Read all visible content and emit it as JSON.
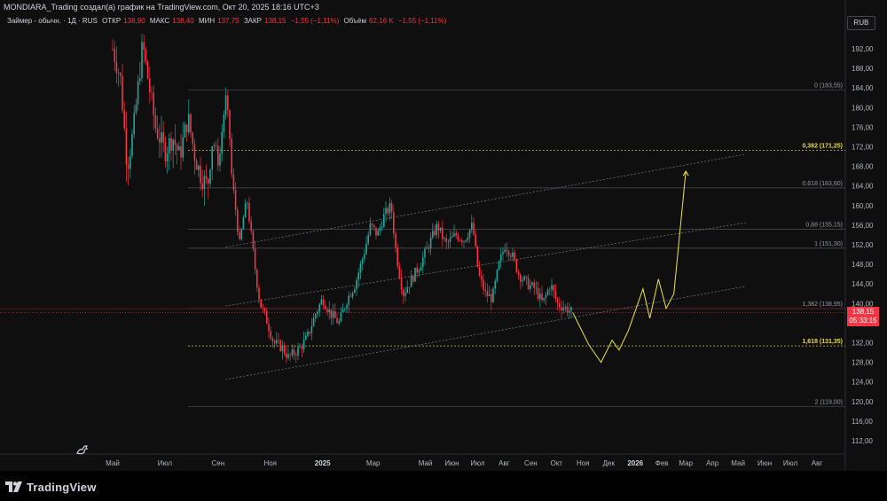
{
  "header": {
    "title": "MONDIARA_Trading создал(а) график на TradingView.com, Окт 20, 2025 18:16 UTC+3"
  },
  "symbol": {
    "name": "Займер - обычн. · 1Д · RUS",
    "open_label": "ОТКР",
    "open": "138,90",
    "high_label": "МАКС",
    "high": "138,40",
    "low_label": "МИН",
    "low": "137,75",
    "close_label": "ЗАКР",
    "close": "138,15",
    "change": "−1,55 (−1,11%)",
    "volume_label": "Объём",
    "volume": "62,16 K",
    "volume_change": "−1,55 (−1,11%)"
  },
  "currency": "RUB",
  "last_price": {
    "value": "138,15",
    "countdown": "05:33:15"
  },
  "footer": {
    "brand": "TradingView"
  },
  "colors": {
    "up": "#26a69a",
    "down": "#f23645",
    "projection": "#f0e34a",
    "fib_gray": "#787b86",
    "fib_highlight": "#e8d84a",
    "background": "#0f0f0f"
  },
  "chart_data": {
    "type": "candlestick",
    "title": "",
    "xlabel": "",
    "ylabel": "",
    "ylim": [
      111,
      194
    ],
    "y_ticks": [
      "192,00",
      "188,00",
      "184,00",
      "180,00",
      "176,00",
      "172,00",
      "168,00",
      "164,00",
      "160,00",
      "156,00",
      "152,00",
      "148,00",
      "144,00",
      "140,00",
      "136,00",
      "132,00",
      "128,00",
      "124,00",
      "120,00",
      "116,00",
      "112,00"
    ],
    "x_ticks": [
      "Май",
      "Июл",
      "Сен",
      "Ноя",
      "2025",
      "Мар",
      "Май",
      "Июн",
      "Июл",
      "Авг",
      "Сен",
      "Окт",
      "Ноя",
      "Дек",
      "2026",
      "Фев",
      "Мар",
      "Апр",
      "Май",
      "Июн",
      "Июл",
      "Авг"
    ],
    "fib_levels": [
      {
        "label": "0 (183,55)",
        "price": 183.55,
        "highlight": false
      },
      {
        "label": "0,382 (171,25)",
        "price": 171.25,
        "highlight": true
      },
      {
        "label": "0,618 (163,60)",
        "price": 163.6,
        "highlight": false
      },
      {
        "label": "0,88 (155,15)",
        "price": 155.15,
        "highlight": false
      },
      {
        "label": "1 (151,30)",
        "price": 151.3,
        "highlight": false
      },
      {
        "label": "1,382 (138,95)",
        "price": 138.95,
        "highlight": false
      },
      {
        "label": "1,618 (131,35)",
        "price": 131.35,
        "highlight": true
      },
      {
        "label": "2 (119,00)",
        "price": 119.0,
        "highlight": false
      }
    ],
    "current_price": 138.15,
    "price_path": [
      [
        "2024-05-01",
        192
      ],
      [
        "2024-05-10",
        186
      ],
      [
        "2024-05-18",
        168
      ],
      [
        "2024-05-25",
        175
      ],
      [
        "2024-06-05",
        193
      ],
      [
        "2024-06-12",
        185
      ],
      [
        "2024-06-20",
        176
      ],
      [
        "2024-07-01",
        171
      ],
      [
        "2024-07-10",
        174
      ],
      [
        "2024-07-18",
        170
      ],
      [
        "2024-07-28",
        178
      ],
      [
        "2024-08-05",
        170
      ],
      [
        "2024-08-12",
        166
      ],
      [
        "2024-08-20",
        164
      ],
      [
        "2024-08-25",
        173
      ],
      [
        "2024-08-29",
        172
      ],
      [
        "2024-09-02",
        168
      ],
      [
        "2024-09-06",
        176
      ],
      [
        "2024-09-10",
        182
      ],
      [
        "2024-09-14",
        176
      ],
      [
        "2024-09-17",
        166
      ],
      [
        "2024-09-21",
        160
      ],
      [
        "2024-09-26",
        152
      ],
      [
        "2024-10-01",
        158
      ],
      [
        "2024-10-05",
        161
      ],
      [
        "2024-10-11",
        152
      ],
      [
        "2024-10-15",
        146
      ],
      [
        "2024-10-20",
        140
      ],
      [
        "2024-10-27",
        137
      ],
      [
        "2024-11-05",
        132
      ],
      [
        "2024-11-15",
        131
      ],
      [
        "2024-11-22",
        129
      ],
      [
        "2024-11-30",
        130
      ],
      [
        "2024-12-06",
        131
      ],
      [
        "2024-12-14",
        133
      ],
      [
        "2024-12-24",
        138
      ],
      [
        "2025-01-01",
        141
      ],
      [
        "2025-01-10",
        138
      ],
      [
        "2025-01-20",
        136
      ],
      [
        "2025-01-30",
        141
      ],
      [
        "2025-02-08",
        144
      ],
      [
        "2025-02-18",
        150
      ],
      [
        "2025-02-26",
        156
      ],
      [
        "2025-03-06",
        154
      ],
      [
        "2025-03-14",
        158
      ],
      [
        "2025-03-22",
        160
      ],
      [
        "2025-03-28",
        150
      ],
      [
        "2025-04-05",
        142
      ],
      [
        "2025-04-15",
        145
      ],
      [
        "2025-04-25",
        148
      ],
      [
        "2025-05-05",
        152
      ],
      [
        "2025-05-15",
        156
      ],
      [
        "2025-05-25",
        152
      ],
      [
        "2025-06-05",
        154
      ],
      [
        "2025-06-15",
        153
      ],
      [
        "2025-06-25",
        156
      ],
      [
        "2025-07-02",
        146
      ],
      [
        "2025-07-10",
        142
      ],
      [
        "2025-07-18",
        141
      ],
      [
        "2025-07-26",
        148
      ],
      [
        "2025-08-02",
        152
      ],
      [
        "2025-08-10",
        150
      ],
      [
        "2025-08-18",
        146
      ],
      [
        "2025-08-28",
        144
      ],
      [
        "2025-09-06",
        143
      ],
      [
        "2025-09-15",
        140
      ],
      [
        "2025-09-24",
        144
      ],
      [
        "2025-10-02",
        140
      ],
      [
        "2025-10-12",
        139
      ],
      [
        "2025-10-20",
        138.15
      ]
    ],
    "projection": [
      [
        "2025-10-20",
        138.15
      ],
      [
        "2025-11-08",
        131.5
      ],
      [
        "2025-11-22",
        128
      ],
      [
        "2025-12-05",
        132.5
      ],
      [
        "2025-12-13",
        130.5
      ],
      [
        "2025-12-24",
        134.5
      ],
      [
        "2026-01-10",
        143
      ],
      [
        "2026-01-18",
        137
      ],
      [
        "2026-01-28",
        145
      ],
      [
        "2026-02-06",
        139
      ],
      [
        "2026-02-15",
        142
      ],
      [
        "2026-03-01",
        167
      ]
    ],
    "channel_lines": [
      {
        "from": [
          "2024-09-10",
          151.5
        ],
        "to": [
          "2026-05-10",
          170.5
        ]
      },
      {
        "from": [
          "2024-09-10",
          139.5
        ],
        "to": [
          "2026-05-10",
          156.5
        ]
      },
      {
        "from": [
          "2024-09-10",
          124.5
        ],
        "to": [
          "2026-05-10",
          143.5
        ]
      }
    ]
  }
}
